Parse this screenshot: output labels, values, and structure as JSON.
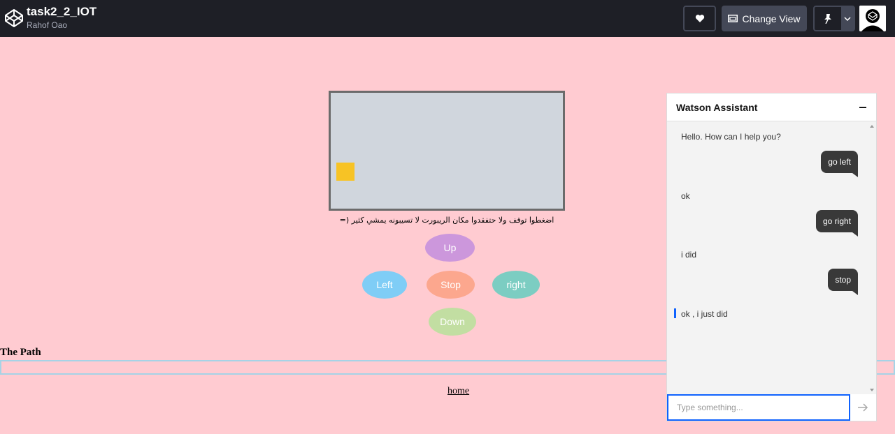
{
  "header": {
    "title": "task2_2_IOT",
    "author": "Rahof Oao",
    "change_view_label": "Change View",
    "icons": [
      "codepen-logo-icon",
      "heart-icon",
      "layout-icon",
      "pin-icon",
      "chevron-down-icon",
      "avatar"
    ]
  },
  "robot": {
    "instruction": "اضغطوا توقف ولا حتفقدوا مكان الريبورت لا تسيبونه يمشي كثير (="
  },
  "controls": {
    "up": "Up",
    "left": "Left",
    "stop": "Stop",
    "right": "right",
    "down": "Down"
  },
  "path_title": "The Path",
  "home_link": "home",
  "watson": {
    "title": "Watson Assistant",
    "messages": [
      {
        "from": "bot",
        "text": "Hello. How can I help you?"
      },
      {
        "from": "user",
        "text": "go left"
      },
      {
        "from": "bot",
        "text": "ok"
      },
      {
        "from": "user",
        "text": "go right"
      },
      {
        "from": "bot",
        "text": "i did"
      },
      {
        "from": "user",
        "text": "stop"
      },
      {
        "from": "bot",
        "text": "ok , i just did"
      }
    ],
    "input_placeholder": "Type something..."
  },
  "colors": {
    "page_bg": "#ffcbd1",
    "topbar_bg": "#1e1f26",
    "robot_box": "#d0d6dd",
    "robot": "#f7c325",
    "up": "#cc97dc",
    "left": "#7fcdf6",
    "stop": "#fca78e",
    "right": "#7ccdc2",
    "down": "#c2dea2",
    "accent": "#0f62fe"
  }
}
